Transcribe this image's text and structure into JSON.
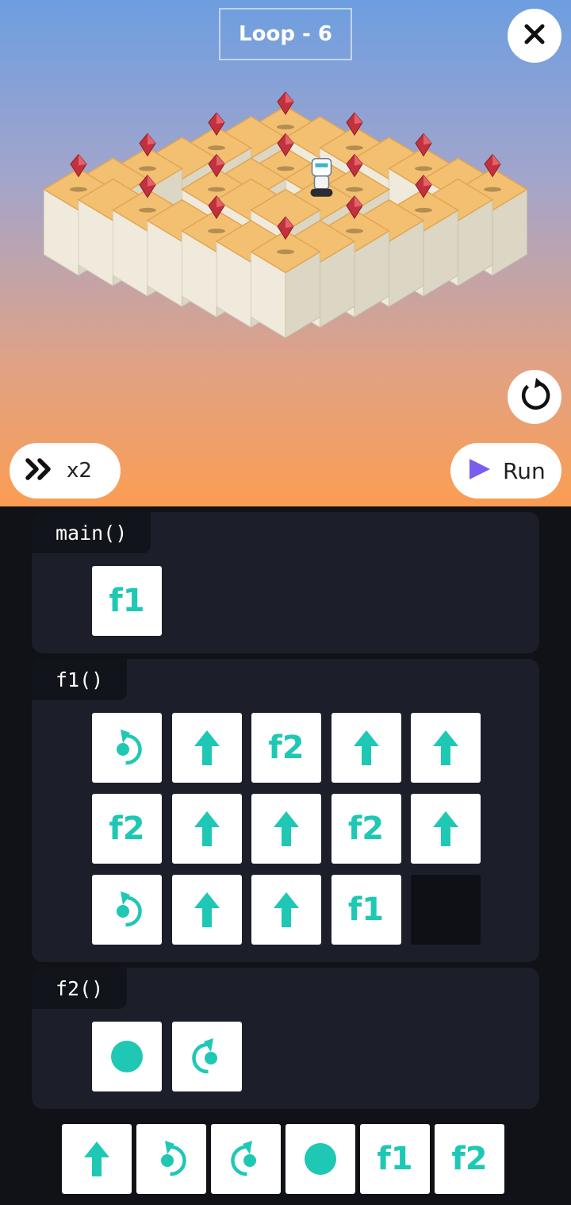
{
  "level": {
    "title": "Loop - 6"
  },
  "controls": {
    "close_icon": "close-icon",
    "reset_icon": "restart-icon",
    "speed_label": "x2",
    "speed_icon": "fast-forward-icon",
    "run_label": "Run",
    "run_icon": "play-icon"
  },
  "colors": {
    "accent_teal": "#1fc8b4",
    "run_purple": "#7b5cf0",
    "tile_top": "#f2c070",
    "tile_side": "#efeadc",
    "gem": "#c2313d"
  },
  "board": {
    "gems": 15,
    "robot": "robot"
  },
  "program": {
    "main": {
      "title": "main()",
      "slots": [
        {
          "cmd": "call",
          "label": "f1"
        }
      ]
    },
    "f1": {
      "title": "f1()",
      "slots": [
        {
          "cmd": "turn-left",
          "label": ""
        },
        {
          "cmd": "forward",
          "label": ""
        },
        {
          "cmd": "call",
          "label": "f2"
        },
        {
          "cmd": "forward",
          "label": ""
        },
        {
          "cmd": "forward",
          "label": ""
        },
        {
          "cmd": "call",
          "label": "f2"
        },
        {
          "cmd": "forward",
          "label": ""
        },
        {
          "cmd": "forward",
          "label": ""
        },
        {
          "cmd": "call",
          "label": "f2"
        },
        {
          "cmd": "forward",
          "label": ""
        },
        {
          "cmd": "turn-left",
          "label": ""
        },
        {
          "cmd": "forward",
          "label": ""
        },
        {
          "cmd": "forward",
          "label": ""
        },
        {
          "cmd": "call",
          "label": "f1"
        },
        {
          "cmd": "empty",
          "label": ""
        }
      ]
    },
    "f2": {
      "title": "f2()",
      "slots": [
        {
          "cmd": "collect",
          "label": ""
        },
        {
          "cmd": "turn-right",
          "label": ""
        }
      ]
    }
  },
  "palette": [
    {
      "cmd": "forward",
      "label": ""
    },
    {
      "cmd": "turn-left",
      "label": ""
    },
    {
      "cmd": "turn-right",
      "label": ""
    },
    {
      "cmd": "collect",
      "label": ""
    },
    {
      "cmd": "call",
      "label": "f1"
    },
    {
      "cmd": "call",
      "label": "f2"
    }
  ]
}
